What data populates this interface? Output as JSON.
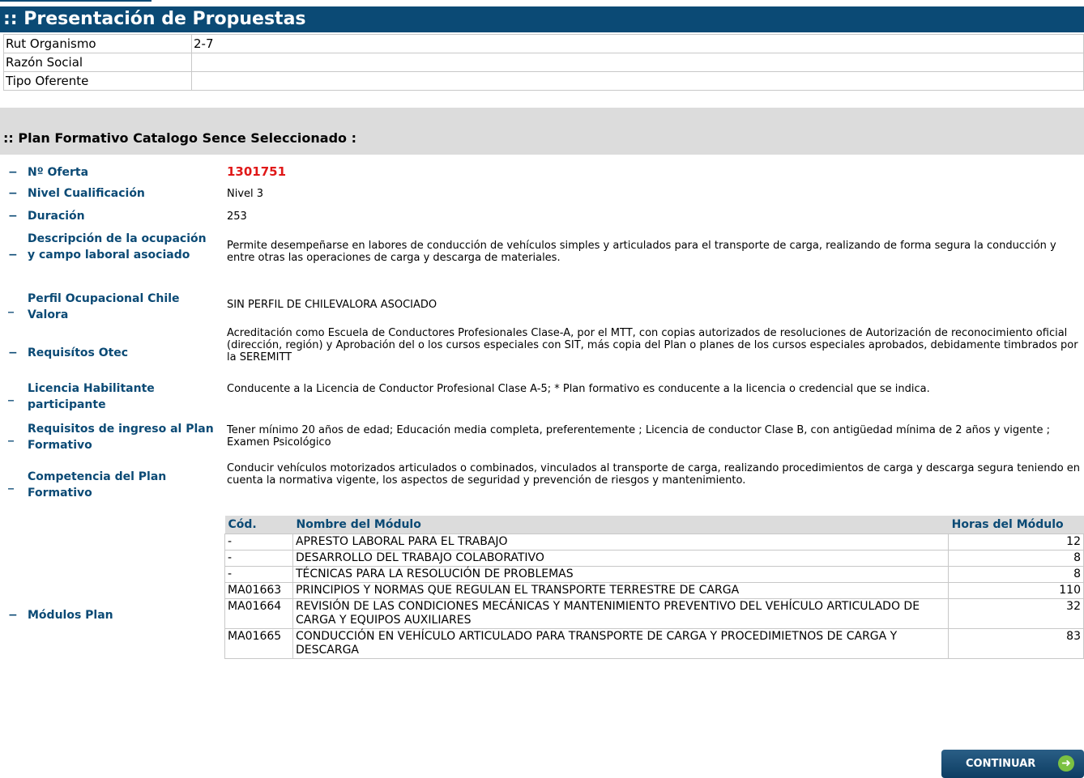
{
  "header": {
    "title": ":: Presentación de Propuestas"
  },
  "organismo": [
    {
      "label": "Rut Organismo",
      "value": "2-7"
    },
    {
      "label": "Razón Social",
      "value": ""
    },
    {
      "label": "Tipo Oferente",
      "value": ""
    }
  ],
  "section": {
    "title": ":: Plan Formativo Catalogo Sence Seleccionado :"
  },
  "details": {
    "oferta_label": "Nº Oferta",
    "oferta_value": "1301751",
    "nivel_label": "Nivel Cualificación",
    "nivel_value": "Nivel 3",
    "duracion_label": "Duración",
    "duracion_value": "253",
    "descripcion_label": "Descripción de la ocupación y campo laboral asociado",
    "descripcion_value": "Permite desempeñarse en labores de conducción de vehículos simples y articulados para el transporte de carga, realizando de forma segura la conducción y entre otras las operaciones de carga y descarga de materiales.",
    "perfil_label": "Perfil Ocupacional Chile Valora",
    "perfil_value": "SIN PERFIL DE CHILEVALORA ASOCIADO",
    "requisitos_otec_label": "Requisítos Otec",
    "requisitos_otec_value": "Acreditación como Escuela de Conductores Profesionales Clase-A, por el MTT, con copias autorizados de resoluciones de Autorización de reconocimiento oficial (dirección, región) y Aprobación del o los cursos especiales con SIT, más copia del Plan o planes de los cursos especiales aprobados, debidamente timbrados por la SEREMITT",
    "licencia_label": "Licencia Habilitante participante",
    "licencia_value": "Conducente a la Licencia de Conductor Profesional Clase A-5; * Plan formativo es conducente a la licencia o credencial que se indica.",
    "ingreso_label": "Requisitos de ingreso al Plan Formativo",
    "ingreso_value": "Tener mínimo 20 años de edad; Educación media completa, preferentemente ; Licencia de conductor Clase B, con antigüedad mínima de 2 años y vigente ; Examen Psicológico",
    "competencia_label": "Competencia del Plan Formativo",
    "competencia_value": "Conducir vehículos motorizados articulados o combinados, vinculados al transporte de carga, realizando procedimientos de carga y descarga segura teniendo en cuenta la normativa vigente, los aspectos de seguridad y prevención de riesgos y mantenimiento.",
    "modulos_label": "Módulos Plan"
  },
  "modules": {
    "headers": {
      "cod": "Cód.",
      "nombre": "Nombre del Módulo",
      "horas": "Horas del Módulo"
    },
    "rows": [
      {
        "cod": "-",
        "nombre": "APRESTO LABORAL PARA EL TRABAJO",
        "horas": "12"
      },
      {
        "cod": "-",
        "nombre": "DESARROLLO DEL TRABAJO COLABORATIVO",
        "horas": "8"
      },
      {
        "cod": "-",
        "nombre": "TÉCNICAS PARA LA RESOLUCIÓN DE PROBLEMAS",
        "horas": "8"
      },
      {
        "cod": "MA01663",
        "nombre": "PRINCIPIOS Y NORMAS QUE REGULAN EL TRANSPORTE TERRESTRE DE CARGA",
        "horas": "110"
      },
      {
        "cod": "MA01664",
        "nombre": "REVISIÓN DE LAS CONDICIONES MECÁNICAS Y MANTENIMIENTO PREVENTIVO DEL VEHÍCULO ARTICULADO DE CARGA Y EQUIPOS AUXILIARES",
        "horas": "32"
      },
      {
        "cod": "MA01665",
        "nombre": "CONDUCCIÓN EN VEHÍCULO ARTICULADO PARA TRANSPORTE DE CARGA Y PROCEDIMIETNOS DE CARGA Y DESCARGA",
        "horas": "83"
      }
    ]
  },
  "button": {
    "label": "CONTINUAR",
    "icon": "arrow-right-circle-icon"
  },
  "colors": {
    "primary": "#0b4a75",
    "accent_red": "#e01818",
    "section_bg": "#dcdcdc",
    "button_icon": "#7bc142"
  }
}
